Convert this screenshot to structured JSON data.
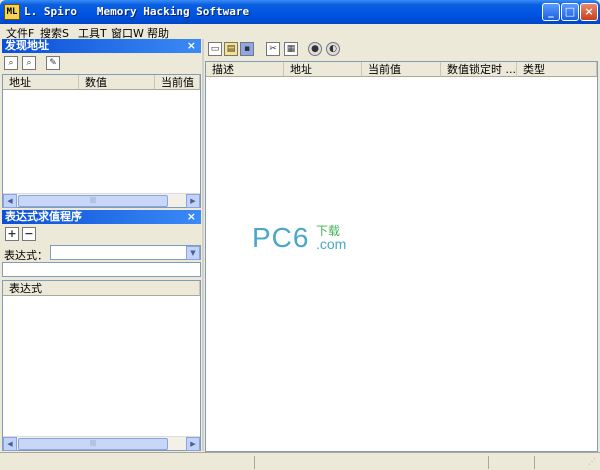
{
  "window": {
    "title": "L. Spiro   Memory Hacking Software",
    "icon": "ML",
    "buttons": [
      "_",
      "□",
      "×"
    ]
  },
  "menu": [
    "文件F",
    "搜索S",
    "工具T",
    "窗口W",
    "帮助"
  ],
  "found_panel": {
    "title": "发现地址",
    "close": "×",
    "columns": [
      "地址",
      "数值",
      "当前值"
    ],
    "scroll_thumb": "|||"
  },
  "expr_panel": {
    "title": "表达式求值程序",
    "close": "×",
    "add": "+",
    "remove": "−",
    "label": "表达式：",
    "input_value": "",
    "list_header": "表达式",
    "scroll_thumb": "|||"
  },
  "main": {
    "columns": [
      "描述",
      "地址",
      "当前值",
      "数值锁定时 ...",
      "类型"
    ]
  },
  "watermark": {
    "big": "PC6",
    "small": "下载",
    "com": ".com"
  },
  "colors": {
    "titlebar": "#0054e3",
    "panel_header": "#0a4fd6",
    "face": "#ece9d8"
  }
}
